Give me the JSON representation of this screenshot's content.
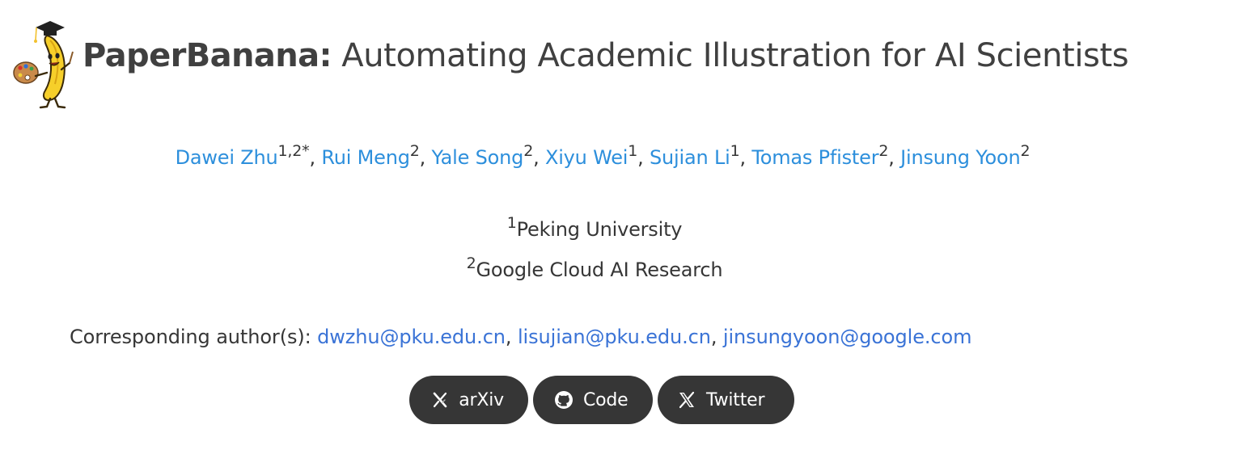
{
  "page": {
    "title_brand": "PaperBanana:",
    "title_rest": " Automating Academic Illustration for AI Scientists"
  },
  "authors": [
    {
      "name": "Dawei Zhu",
      "sup": "1,2*"
    },
    {
      "name": "Rui Meng",
      "sup": "2"
    },
    {
      "name": "Yale Song",
      "sup": "2"
    },
    {
      "name": "Xiyu Wei",
      "sup": "1"
    },
    {
      "name": "Sujian Li",
      "sup": "1"
    },
    {
      "name": "Tomas Pfister",
      "sup": "2"
    },
    {
      "name": "Jinsung Yoon",
      "sup": "2"
    }
  ],
  "separator": ", ",
  "affiliations": [
    {
      "sup": "1",
      "name": "Peking University"
    },
    {
      "sup": "2",
      "name": "Google Cloud AI Research"
    }
  ],
  "corresponding": {
    "label": "Corresponding author(s): ",
    "emails": [
      "dwzhu@pku.edu.cn",
      "lisujian@pku.edu.cn",
      "jinsungyoon@google.com"
    ]
  },
  "links": [
    {
      "label": "arXiv",
      "icon": "arxiv-icon"
    },
    {
      "label": "Code",
      "icon": "github-icon"
    },
    {
      "label": "Twitter",
      "icon": "x-twitter-icon"
    }
  ],
  "colors": {
    "author_link": "#2d8fdc",
    "email_link": "#3a73d6",
    "text": "#363636",
    "button_bg": "#363636",
    "button_text": "#ffffff"
  }
}
